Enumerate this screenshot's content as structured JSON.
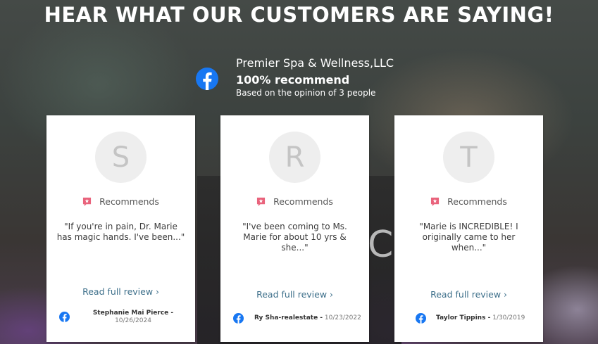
{
  "header": {
    "title": "HEAR WHAT OUR CUSTOMERS ARE SAYING!"
  },
  "summary": {
    "business_name": "Premier Spa & Wellness,LLC",
    "recommend_text": "100% recommend",
    "based_on": "Based on the opinion of 3 people",
    "icon": "facebook-icon"
  },
  "colors": {
    "facebook": "#1877F2",
    "link": "#3d6f8a",
    "recommend_icon": "#e9637c"
  },
  "reviews": [
    {
      "initial": "S",
      "recommend_label": "Recommends",
      "quote": "\"If you're in pain, Dr. Marie has magic hands. I've been...\"",
      "read_more": "Read full review",
      "reviewer": "Stephanie Mai Pierce -",
      "date": "10/26/2024"
    },
    {
      "initial": "R",
      "recommend_label": "Recommends",
      "quote": "\"I've been coming to Ms. Marie for about 10 yrs & she...\"",
      "read_more": "Read full review",
      "reviewer": "Ry Sha-realestate -",
      "date": "10/23/2022"
    },
    {
      "initial": "T",
      "recommend_label": "Recommends",
      "quote": "\"Marie is INCREDIBLE! I originally came to her when...\"",
      "read_more": "Read full review",
      "reviewer": "Taylor Tippins -",
      "date": "1/30/2019"
    }
  ]
}
